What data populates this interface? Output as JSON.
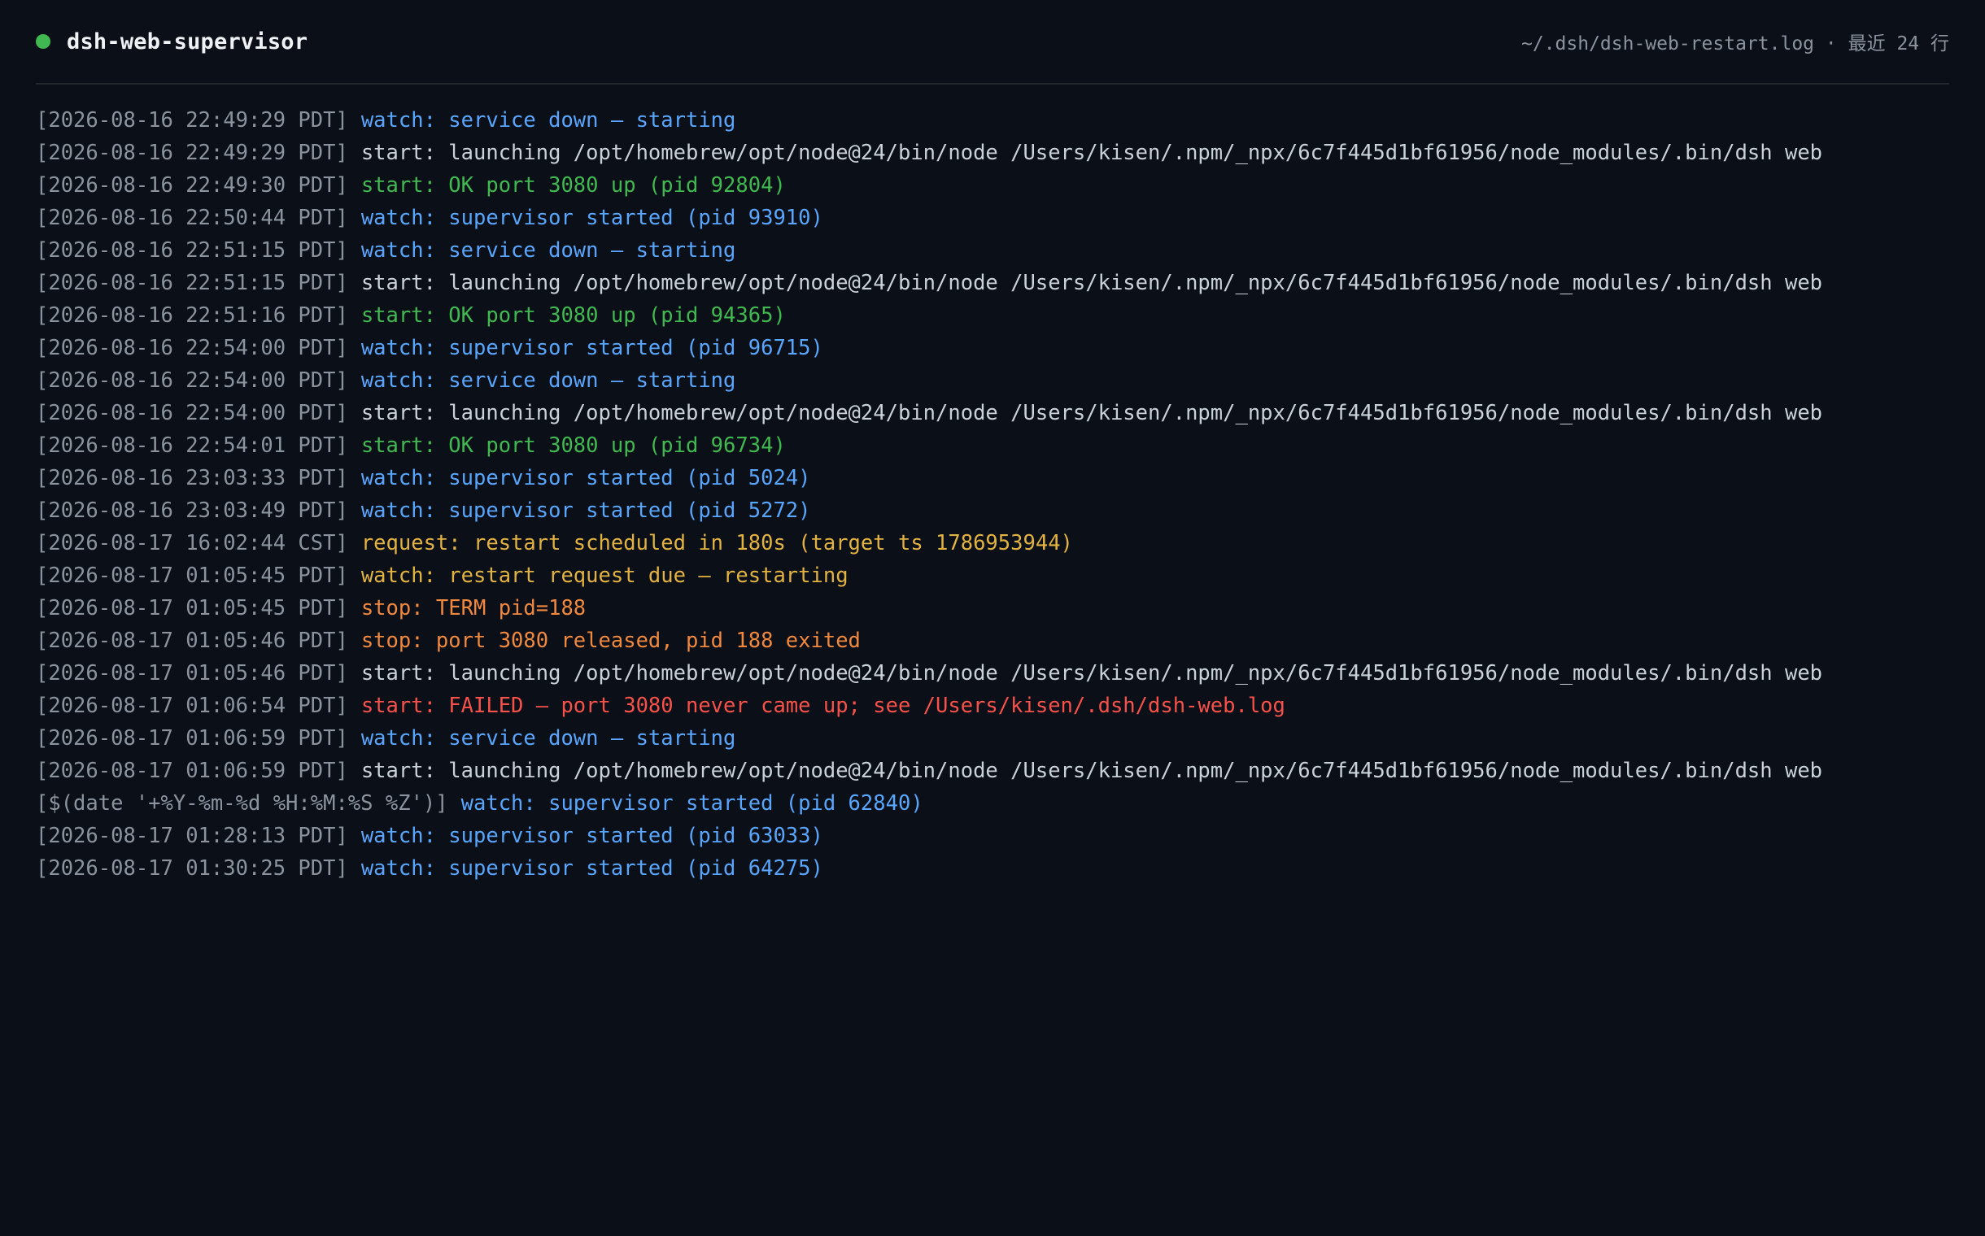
{
  "header": {
    "title": "dsh-web-supervisor",
    "status_color": "#3fb950",
    "log_path": "~/.dsh/dsh-web-restart.log",
    "separator": "·",
    "line_count_label": "最近 24 行"
  },
  "colors": {
    "background": "#0b0f17",
    "timestamp": "#8b949e",
    "watch": "#58a6ff",
    "launch": "#c9d1d9",
    "ok": "#3fb950",
    "request": "#e3b341",
    "stop": "#f0883e",
    "failed": "#f85149"
  },
  "log_lines": [
    {
      "ts": "[2026-08-16 22:49:29 PDT]",
      "msg": "watch: service down — starting",
      "level": "blue"
    },
    {
      "ts": "[2026-08-16 22:49:29 PDT]",
      "msg": "start: launching /opt/homebrew/opt/node@24/bin/node /Users/kisen/.npm/_npx/6c7f445d1bf61956/node_modules/.bin/dsh web",
      "level": "gray"
    },
    {
      "ts": "[2026-08-16 22:49:30 PDT]",
      "msg": "start: OK port 3080 up (pid 92804)",
      "level": "green"
    },
    {
      "ts": "[2026-08-16 22:50:44 PDT]",
      "msg": "watch: supervisor started (pid 93910)",
      "level": "blue"
    },
    {
      "ts": "[2026-08-16 22:51:15 PDT]",
      "msg": "watch: service down — starting",
      "level": "blue"
    },
    {
      "ts": "[2026-08-16 22:51:15 PDT]",
      "msg": "start: launching /opt/homebrew/opt/node@24/bin/node /Users/kisen/.npm/_npx/6c7f445d1bf61956/node_modules/.bin/dsh web",
      "level": "gray"
    },
    {
      "ts": "[2026-08-16 22:51:16 PDT]",
      "msg": "start: OK port 3080 up (pid 94365)",
      "level": "green"
    },
    {
      "ts": "[2026-08-16 22:54:00 PDT]",
      "msg": "watch: supervisor started (pid 96715)",
      "level": "blue"
    },
    {
      "ts": "[2026-08-16 22:54:00 PDT]",
      "msg": "watch: service down — starting",
      "level": "blue"
    },
    {
      "ts": "[2026-08-16 22:54:00 PDT]",
      "msg": "start: launching /opt/homebrew/opt/node@24/bin/node /Users/kisen/.npm/_npx/6c7f445d1bf61956/node_modules/.bin/dsh web",
      "level": "gray"
    },
    {
      "ts": "[2026-08-16 22:54:01 PDT]",
      "msg": "start: OK port 3080 up (pid 96734)",
      "level": "green"
    },
    {
      "ts": "[2026-08-16 23:03:33 PDT]",
      "msg": "watch: supervisor started (pid 5024)",
      "level": "blue"
    },
    {
      "ts": "[2026-08-16 23:03:49 PDT]",
      "msg": "watch: supervisor started (pid 5272)",
      "level": "blue"
    },
    {
      "ts": "[2026-08-17 16:02:44 CST]",
      "msg": "request: restart scheduled in 180s (target ts 1786953944)",
      "level": "yellow"
    },
    {
      "ts": "[2026-08-17 01:05:45 PDT]",
      "msg": "watch: restart request due — restarting",
      "level": "yellow"
    },
    {
      "ts": "[2026-08-17 01:05:45 PDT]",
      "msg": "stop: TERM pid=188",
      "level": "orange"
    },
    {
      "ts": "[2026-08-17 01:05:46 PDT]",
      "msg": "stop: port 3080 released, pid 188 exited",
      "level": "orange"
    },
    {
      "ts": "[2026-08-17 01:05:46 PDT]",
      "msg": "start: launching /opt/homebrew/opt/node@24/bin/node /Users/kisen/.npm/_npx/6c7f445d1bf61956/node_modules/.bin/dsh web",
      "level": "gray"
    },
    {
      "ts": "[2026-08-17 01:06:54 PDT]",
      "msg": "start: FAILED — port 3080 never came up; see /Users/kisen/.dsh/dsh-web.log",
      "level": "red"
    },
    {
      "ts": "[2026-08-17 01:06:59 PDT]",
      "msg": "watch: service down — starting",
      "level": "blue"
    },
    {
      "ts": "[2026-08-17 01:06:59 PDT]",
      "msg": "start: launching /opt/homebrew/opt/node@24/bin/node /Users/kisen/.npm/_npx/6c7f445d1bf61956/node_modules/.bin/dsh web",
      "level": "gray"
    },
    {
      "ts": "[$(date '+%Y-%m-%d %H:%M:%S %Z')]",
      "msg": "watch: supervisor started (pid 62840)",
      "level": "blue"
    },
    {
      "ts": "[2026-08-17 01:28:13 PDT]",
      "msg": "watch: supervisor started (pid 63033)",
      "level": "blue"
    },
    {
      "ts": "[2026-08-17 01:30:25 PDT]",
      "msg": "watch: supervisor started (pid 64275)",
      "level": "blue"
    }
  ]
}
